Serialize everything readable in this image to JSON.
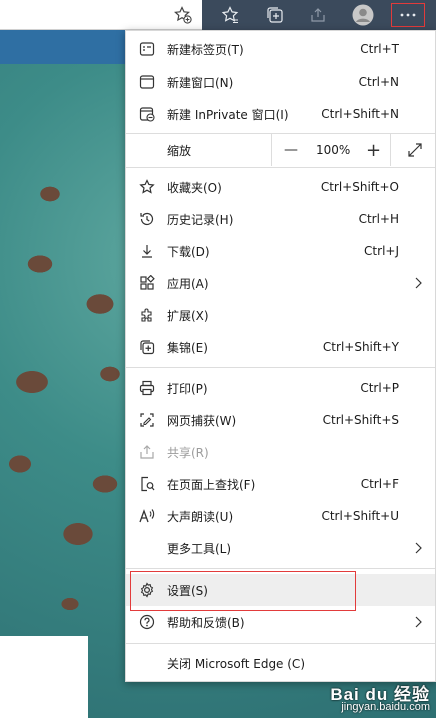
{
  "toolbar": {
    "icons": [
      "add-favorite-icon",
      "favorites-icon",
      "collections-icon",
      "share-icon",
      "profile-avatar",
      "more-icon"
    ]
  },
  "menu": {
    "new_tab": {
      "label": "新建标签页(T)",
      "shortcut": "Ctrl+T"
    },
    "new_window": {
      "label": "新建窗口(N)",
      "shortcut": "Ctrl+N"
    },
    "new_inprivate": {
      "label": "新建 InPrivate 窗口(I)",
      "shortcut": "Ctrl+Shift+N"
    },
    "zoom": {
      "label": "缩放",
      "minus": "—",
      "value": "100%",
      "plus": "+"
    },
    "favorites": {
      "label": "收藏夹(O)",
      "shortcut": "Ctrl+Shift+O"
    },
    "history": {
      "label": "历史记录(H)",
      "shortcut": "Ctrl+H"
    },
    "downloads": {
      "label": "下载(D)",
      "shortcut": "Ctrl+J"
    },
    "apps": {
      "label": "应用(A)"
    },
    "extensions": {
      "label": "扩展(X)"
    },
    "collections": {
      "label": "集锦(E)",
      "shortcut": "Ctrl+Shift+Y"
    },
    "print": {
      "label": "打印(P)",
      "shortcut": "Ctrl+P"
    },
    "web_capture": {
      "label": "网页捕获(W)",
      "shortcut": "Ctrl+Shift+S"
    },
    "share": {
      "label": "共享(R)"
    },
    "find": {
      "label": "在页面上查找(F)",
      "shortcut": "Ctrl+F"
    },
    "read_aloud": {
      "label": "大声朗读(U)",
      "shortcut": "Ctrl+Shift+U"
    },
    "more_tools": {
      "label": "更多工具(L)"
    },
    "settings": {
      "label": "设置(S)"
    },
    "help": {
      "label": "帮助和反馈(B)"
    },
    "close_edge": {
      "label": "关闭 Microsoft Edge (C)"
    }
  },
  "watermark": {
    "line1": "Bai du 经验",
    "line2": "jingyan.baidu.com"
  },
  "colors": {
    "highlight": "#e23b3b",
    "toolbar": "#3b4a5c",
    "accent_strip": "#2f6fa3"
  }
}
